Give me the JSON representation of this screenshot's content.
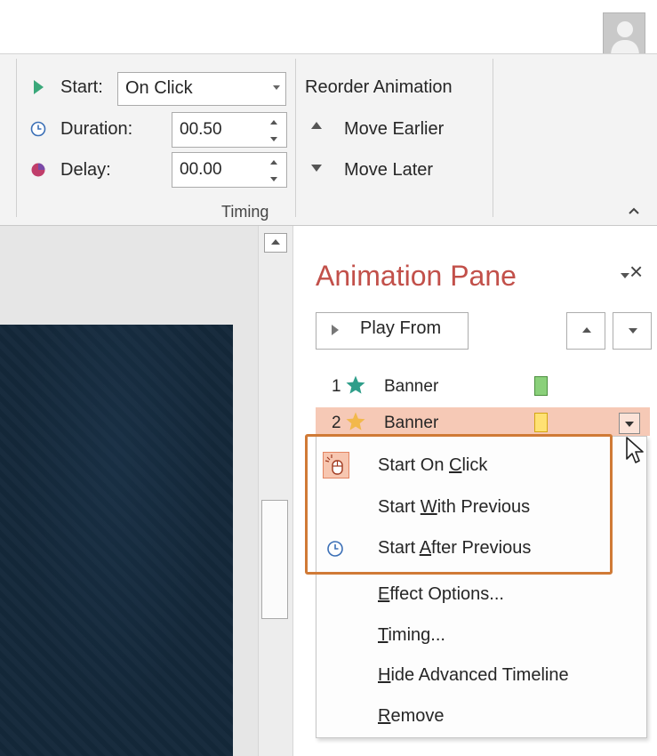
{
  "ribbon": {
    "start_label": "Start:",
    "start_value": "On Click",
    "duration_label": "Duration:",
    "duration_value": "00.50",
    "delay_label": "Delay:",
    "delay_value": "00.00",
    "reorder_title": "Reorder Animation",
    "move_earlier": "Move Earlier",
    "move_later": "Move Later",
    "group_label": "Timing",
    "collapse_icon": "^"
  },
  "pane": {
    "title": "Animation Pane",
    "close_icon": "×",
    "play_from": "Play From",
    "items": [
      {
        "number": "1",
        "name": "Banner",
        "star_color": "#2f9e8a",
        "swatch_color": "#8ad07a",
        "swatch_border": "#4c8f3f"
      },
      {
        "number": "2",
        "name": "Banner",
        "star_color": "#f2b84b",
        "swatch_color": "#ffe173",
        "swatch_border": "#d4a514",
        "selected": true
      }
    ]
  },
  "menu": {
    "items": [
      {
        "label": "Start On Click",
        "underline_char": "C",
        "icon": "mouse-click-icon"
      },
      {
        "label": "Start With Previous",
        "underline_char": "W",
        "icon": ""
      },
      {
        "label": "Start After Previous",
        "underline_char": "A",
        "icon": "clock-icon"
      },
      {
        "label": "Effect Options...",
        "underline_char": "E",
        "icon": ""
      },
      {
        "label": "Timing...",
        "underline_char": "T",
        "icon": ""
      },
      {
        "label": "Hide Advanced Timeline",
        "underline_char": "H",
        "icon": ""
      },
      {
        "label": "Remove",
        "underline_char": "R",
        "icon": ""
      }
    ]
  },
  "colors": {
    "accent_title": "#c2504a",
    "highlight_border": "#d07a36",
    "selected_row": "#f6c9b6"
  }
}
